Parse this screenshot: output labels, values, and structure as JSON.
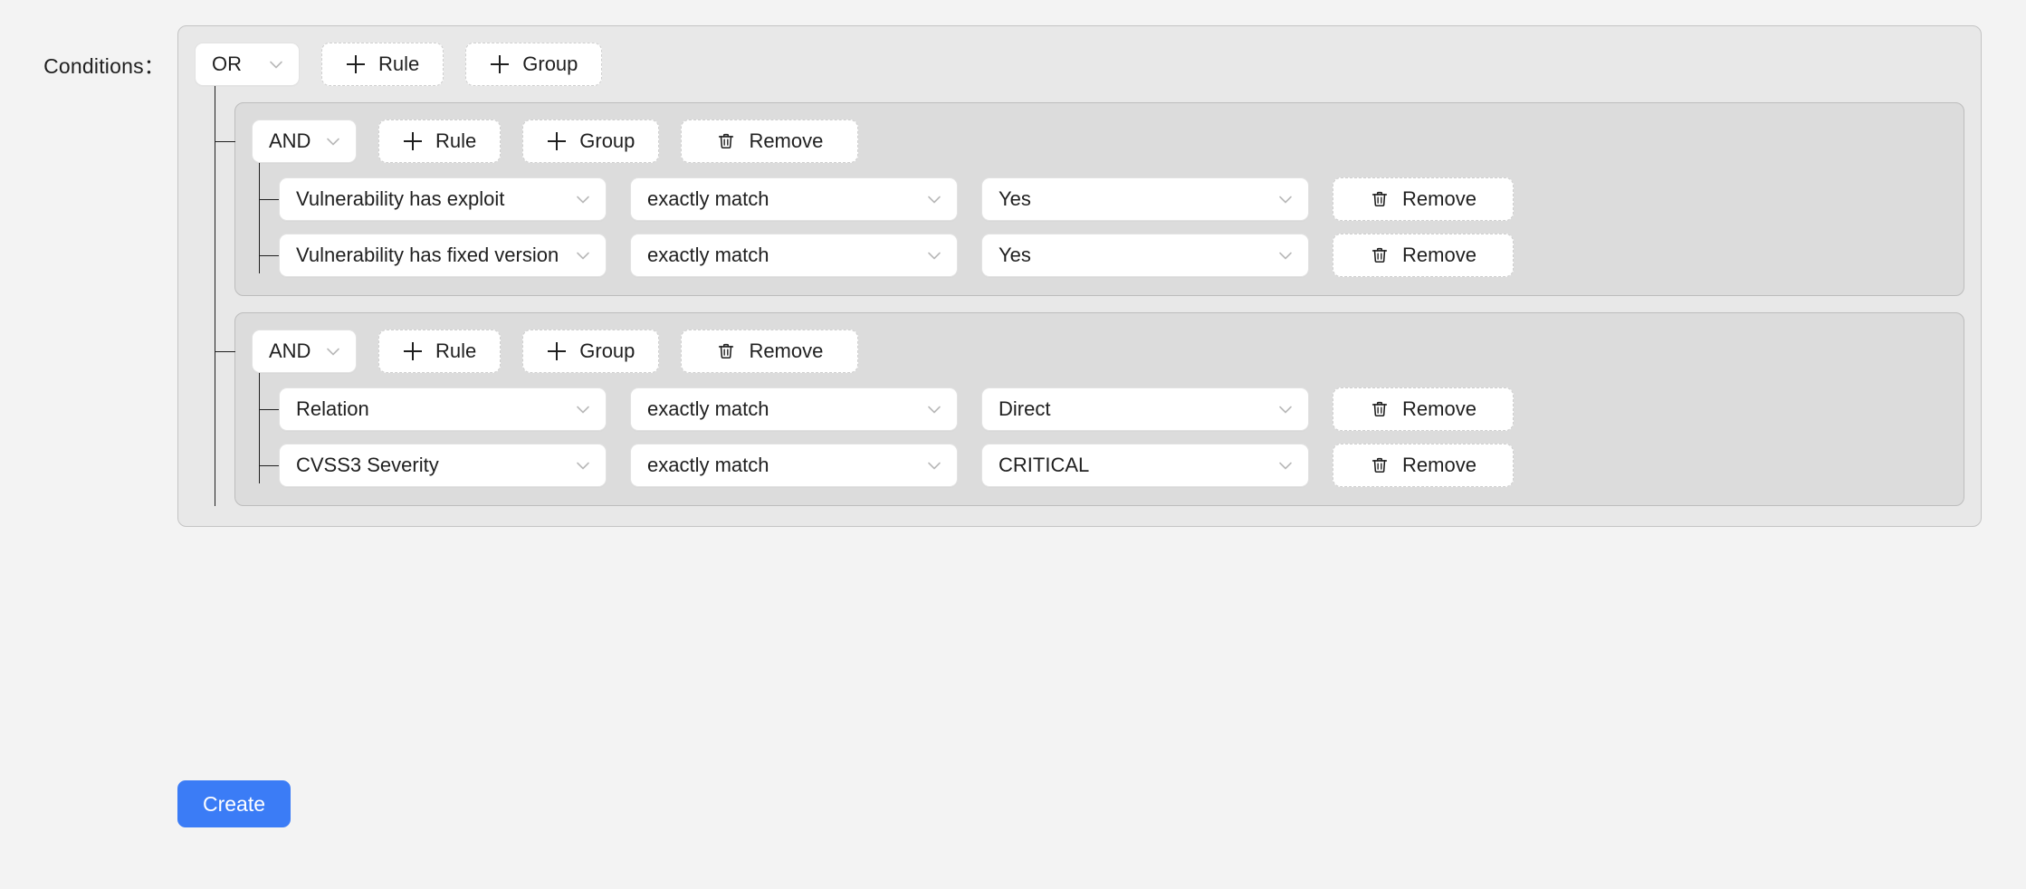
{
  "label": "Conditions：",
  "colors": {
    "page_bg": "#f3f3f3",
    "root_group_bg": "#e8e8e8",
    "subgroup_bg": "#dcdcdc",
    "create_button": "#3b7cf6",
    "connector_line": "#1f1f1f"
  },
  "root": {
    "operator": "OR",
    "add_rule_label": "Rule",
    "add_group_label": "Group",
    "plus_icon": "plus-icon",
    "caret_icon": "chevron-down-icon"
  },
  "groups": [
    {
      "operator": "AND",
      "add_rule_label": "Rule",
      "add_group_label": "Group",
      "remove_label": "Remove",
      "trash_icon": "trash-icon",
      "rules": [
        {
          "field": "Vulnerability has exploit",
          "operator": "exactly match",
          "value": "Yes",
          "remove_label": "Remove"
        },
        {
          "field": "Vulnerability has fixed version",
          "operator": "exactly match",
          "value": "Yes",
          "remove_label": "Remove"
        }
      ]
    },
    {
      "operator": "AND",
      "add_rule_label": "Rule",
      "add_group_label": "Group",
      "remove_label": "Remove",
      "trash_icon": "trash-icon",
      "rules": [
        {
          "field": "Relation",
          "operator": "exactly match",
          "value": "Direct",
          "remove_label": "Remove"
        },
        {
          "field": "CVSS3 Severity",
          "operator": "exactly match",
          "value": "CRITICAL",
          "remove_label": "Remove"
        }
      ]
    }
  ],
  "create_button_label": "Create"
}
